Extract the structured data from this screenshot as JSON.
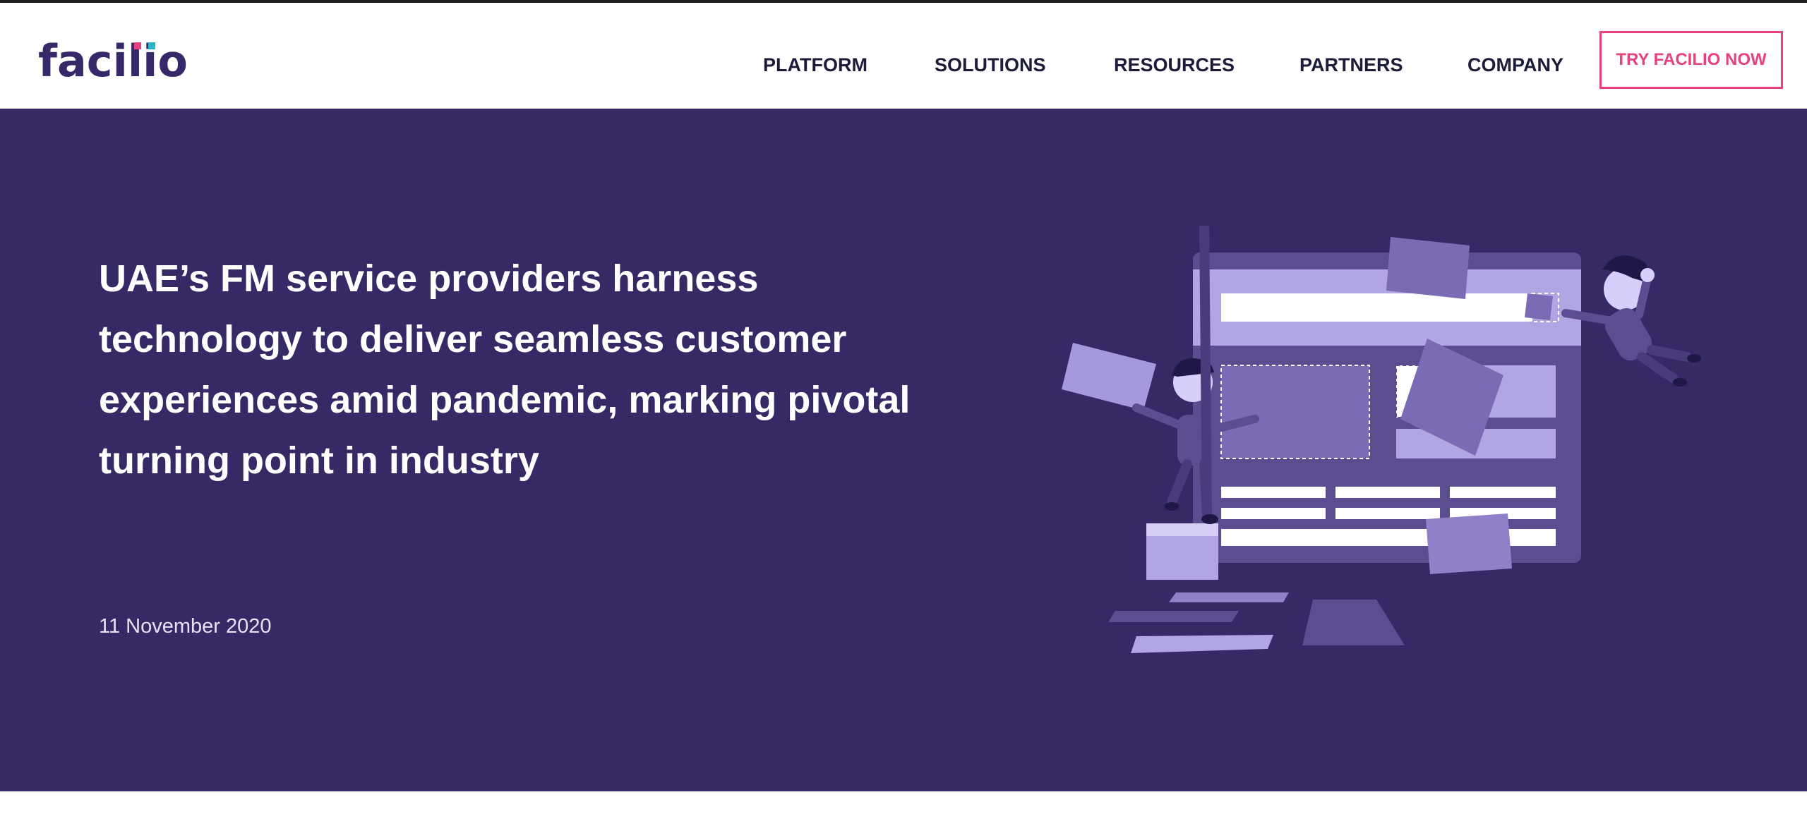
{
  "header": {
    "logo_text": "facilio",
    "nav": [
      "PLATFORM",
      "SOLUTIONS",
      "RESOURCES",
      "PARTNERS",
      "COMPANY"
    ],
    "cta_label": "TRY FACILIO NOW"
  },
  "hero": {
    "headline_lines": [
      "UAE’s FM service providers harness",
      "technology to deliver seamless customer",
      "experiences amid pandemic, marking pivotal",
      "turning point in industry"
    ],
    "date": "11 November 2020"
  },
  "colors": {
    "brand_purple": "#372966",
    "accent_pink": "#e8417f",
    "logo_dot_pink": "#e8417f",
    "logo_dot_teal": "#2bb5c4"
  }
}
